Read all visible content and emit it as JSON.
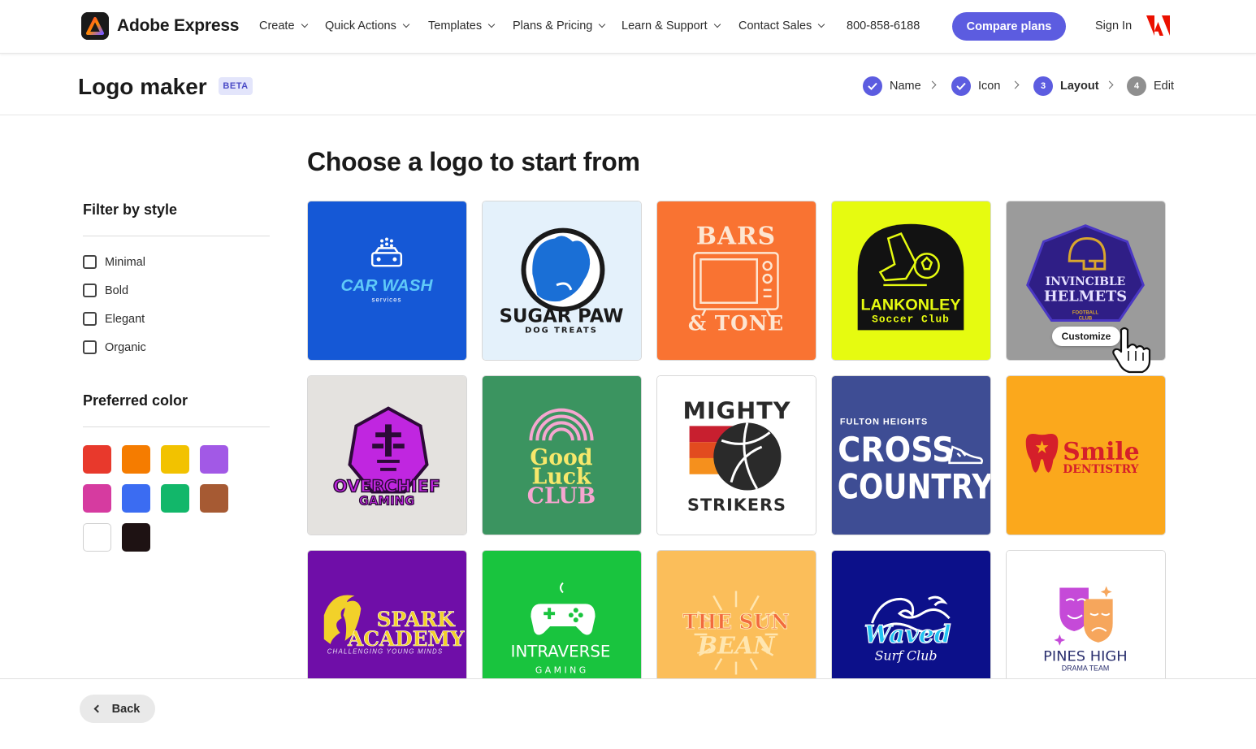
{
  "nav": {
    "brand": "Adobe Express",
    "items": [
      "Create",
      "Quick Actions",
      "Templates",
      "Plans & Pricing",
      "Learn & Support",
      "Contact Sales"
    ],
    "phone": "800-858-6188",
    "compare_label": "Compare plans",
    "signin_label": "Sign In"
  },
  "header": {
    "title": "Logo maker",
    "badge": "BETA",
    "steps": [
      {
        "label": "Name",
        "state": "done",
        "marker": "check"
      },
      {
        "label": "Icon",
        "state": "done",
        "marker": "check"
      },
      {
        "label": "Layout",
        "state": "current",
        "marker": "3"
      },
      {
        "label": "Edit",
        "state": "upcoming",
        "marker": "4"
      }
    ]
  },
  "main": {
    "heading": "Choose a logo to start from",
    "customize_label": "Customize"
  },
  "sidebar": {
    "filter_title": "Filter by style",
    "styles": [
      "Minimal",
      "Bold",
      "Elegant",
      "Organic"
    ],
    "color_title": "Preferred color",
    "colors": [
      "#e8392c",
      "#f57c00",
      "#f2c200",
      "#a259e6",
      "#d63ba0",
      "#3b6cf2",
      "#12b76a",
      "#a65a33",
      "#ffffff",
      "#1e1213"
    ]
  },
  "logos": [
    {
      "line1": "CAR WASH",
      "line2": "services",
      "bg": "#1558d6"
    },
    {
      "line1": "SUGAR PAW",
      "line2": "DOG TREATS",
      "bg": "#e4f1fb"
    },
    {
      "line1": "BARS",
      "line2": "& TONE",
      "bg": "#f97332"
    },
    {
      "line1": "LANKONLEY",
      "line2": "Soccer Club",
      "bg": "#e6fb10"
    },
    {
      "line1": "INVINCIBLE",
      "line2": "HELMETS",
      "line3": "FOOTBALL",
      "line4": "CLUB",
      "bg": "#9b9b9b"
    },
    {
      "line1": "OVERCHIEF",
      "line2": "GAMING",
      "bg": "#e4e2df"
    },
    {
      "line1": "Good",
      "line2": "Luck",
      "line3": "CLUB",
      "bg": "#3b9460"
    },
    {
      "line1": "MIGHTY",
      "line2": "STRIKERS",
      "bg": "#ffffff"
    },
    {
      "line1": "FULTON HEIGHTS",
      "line2": "CROSS",
      "line3": "COUNTRY",
      "bg": "#3e4d94"
    },
    {
      "line1": "Smile",
      "line2": "DENTISTRY",
      "bg": "#fba81c"
    },
    {
      "line1": "SPARK",
      "line2": "ACADEMY",
      "line3": "CHALLENGING YOUNG MINDS",
      "bg": "#6f0ea8"
    },
    {
      "line1": "INTRAVERSE",
      "line2": "G A M I N G",
      "bg": "#19c43e"
    },
    {
      "line1": "THE SUN",
      "line2": "BEAN",
      "bg": "#fbbe5a"
    },
    {
      "line1": "Waved",
      "line2": "Surf Club",
      "bg": "#0c108a"
    },
    {
      "line1": "PINES HIGH",
      "line2": "DRAMA TEAM",
      "bg": "#ffffff"
    }
  ],
  "footer": {
    "back_label": "Back"
  }
}
